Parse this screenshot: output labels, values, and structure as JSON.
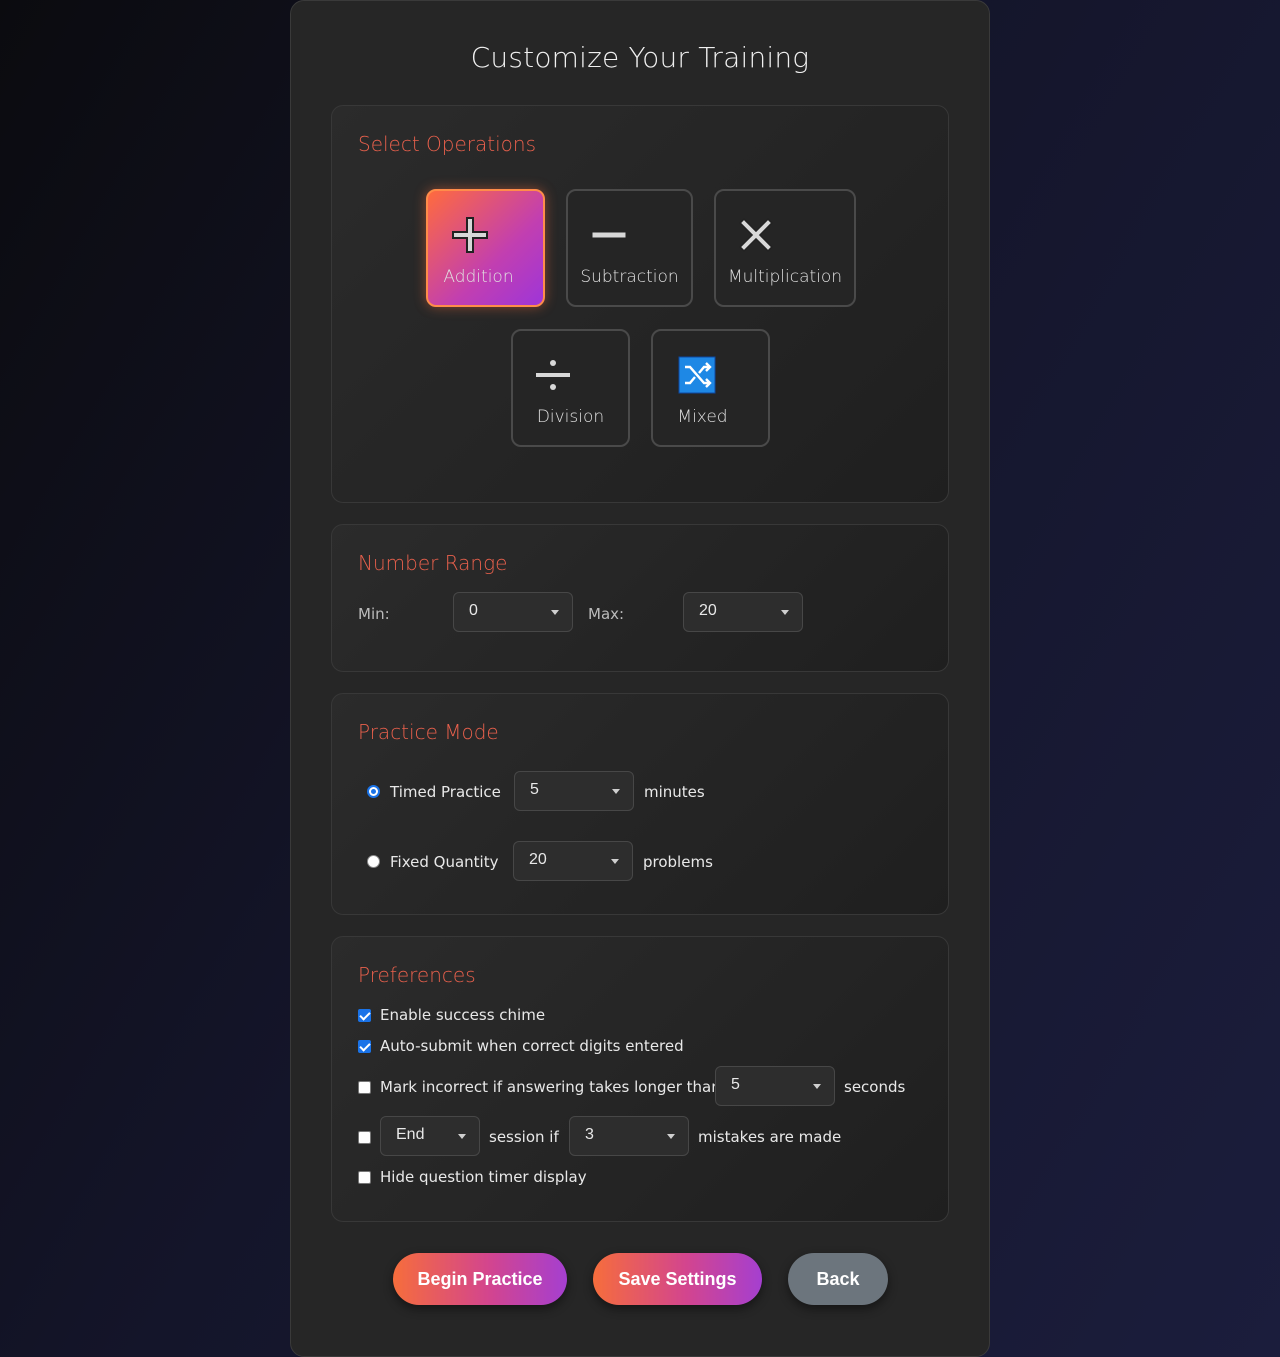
{
  "title": "Customize Your Training",
  "operations": {
    "heading": "Select Operations",
    "items": [
      {
        "label": "Addition",
        "icon": "plus-icon",
        "selected": true
      },
      {
        "label": "Subtraction",
        "icon": "minus-icon",
        "selected": false
      },
      {
        "label": "Multiplication",
        "icon": "times-icon",
        "selected": false
      },
      {
        "label": "Division",
        "icon": "divide-icon",
        "selected": false
      },
      {
        "label": "Mixed",
        "icon": "shuffle-icon",
        "selected": false
      }
    ]
  },
  "range": {
    "heading": "Number Range",
    "min_label": "Min:",
    "min_value": "0",
    "max_label": "Max:",
    "max_value": "20"
  },
  "mode": {
    "heading": "Practice Mode",
    "timed_label": "Timed Practice",
    "timed_value": "5",
    "timed_unit": "minutes",
    "timed_selected": true,
    "fixed_label": "Fixed Quantity",
    "fixed_value": "20",
    "fixed_unit": "problems",
    "fixed_selected": false
  },
  "preferences": {
    "heading": "Preferences",
    "chime_label": "Enable success chime",
    "chime_checked": true,
    "autosubmit_label": "Auto-submit when correct digits entered",
    "autosubmit_checked": true,
    "timeout_label": "Mark incorrect if answering takes longer than",
    "timeout_value": "5",
    "timeout_unit": "seconds",
    "timeout_checked": false,
    "end_action": "End",
    "end_middle": "session if",
    "end_mistakes": "3",
    "end_suffix": "mistakes are made",
    "end_checked": false,
    "hide_timer_label": "Hide question timer display",
    "hide_timer_checked": false
  },
  "buttons": {
    "begin": "Begin Practice",
    "save": "Save Settings",
    "back": "Back"
  },
  "colors": {
    "accent": "#e8604c",
    "gradient_start": "#f66d3c",
    "gradient_end": "#a53fd0",
    "back_button": "#6c757d",
    "checkbox": "#1a73e8"
  }
}
